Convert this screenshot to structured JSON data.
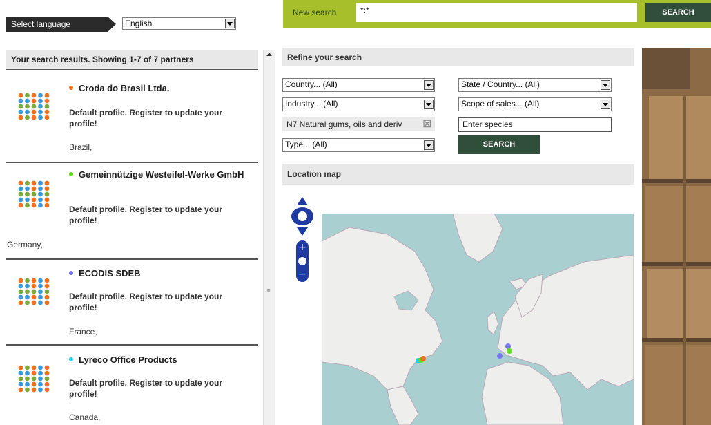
{
  "language": {
    "label": "Select language",
    "selected": "English"
  },
  "top_search": {
    "label": "New search",
    "value": "*:*",
    "button": "SEARCH"
  },
  "results": {
    "header": "Your search results. Showing 1-7 of 7 partners",
    "items": [
      {
        "name": "Croda do Brasil Ltda.",
        "dot_color": "#f07020",
        "description": "Default profile. Register to update your profile!",
        "country": "Brazil,"
      },
      {
        "name": "Gemeinnützige Westeifel-Werke GmbH",
        "dot_color": "#66dd22",
        "description": "Default profile. Register to update your profile!",
        "country": "Germany,"
      },
      {
        "name": "ECODIS SDEB",
        "dot_color": "#7777ee",
        "description": "Default profile. Register to update your profile!",
        "country": "France,"
      },
      {
        "name": "Lyreco Office Products",
        "dot_color": "#22ccee",
        "description": "Default profile. Register to update your profile!",
        "country": "Canada,"
      }
    ]
  },
  "refine": {
    "title": "Refine your search",
    "country": "Country... (All)",
    "state": "State / Country... (All)",
    "industry": "Industry... (All)",
    "scope": "Scope of sales... (All)",
    "species_chip": "N7 Natural gums, oils and deriv",
    "species_placeholder": "Enter species",
    "type": "Type... (All)",
    "button": "SEARCH"
  },
  "map": {
    "title": "Location map"
  },
  "colors": {
    "accent_green": "#a6bf2a",
    "button_dark": "#2f4f3a",
    "map_water": "#aacfd0",
    "map_land": "#eeeeec"
  }
}
